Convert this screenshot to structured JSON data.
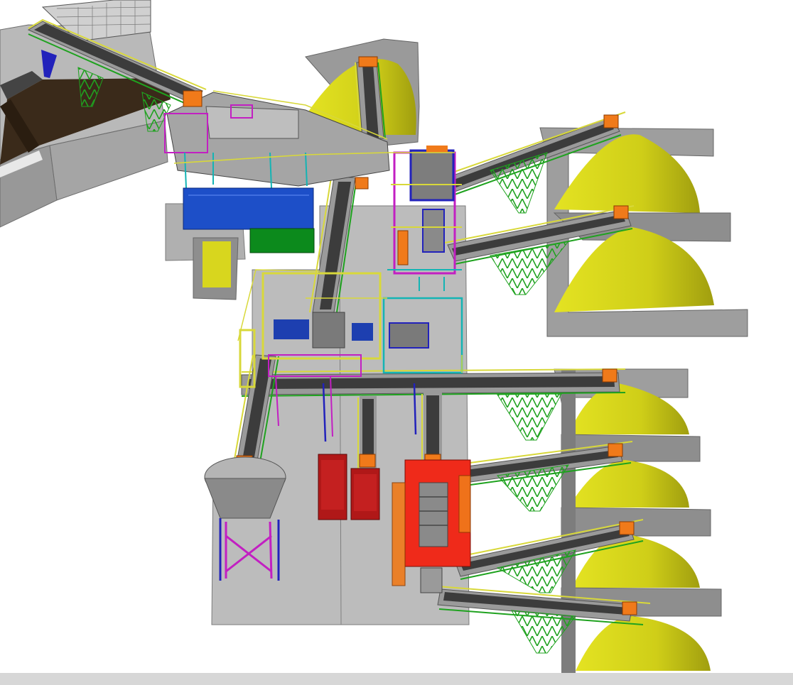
{
  "scene": {
    "kind": "3d-cad-model",
    "subject": "aggregate-crushing-and-screening-plant",
    "components": {
      "stockpiles": 6,
      "radial_stacker_conveyors": 7,
      "transfer_conveyors": 4,
      "screen_towers": 2,
      "hoppers": 1,
      "feeder_bins": 1,
      "rejects_skips": 2,
      "electrical_rooms": 2,
      "wash_plant_module": 1
    }
  },
  "colors": {
    "background": "#ffffff",
    "concrete": "#b4b4b4",
    "concrete_dark": "#8e8e8e",
    "wall_face": "#9a9a9a",
    "soil": "#3a2a1a",
    "stockpile": "#d7d61a",
    "stockpile_shade": "#9c9a10",
    "conveyor_belt": "#3c3c3c",
    "walkway": "#9a9a9a",
    "handrail": "#d8d83a",
    "support_truss": "#1fa21f",
    "structure_magenta": "#c21fc2",
    "structure_blue": "#2222bb",
    "structure_cyan": "#14b4b4",
    "drive_head": "#f07a1a",
    "electrical_room_blue": "#1d4fc8",
    "electrical_room_green": "#0c8a1c",
    "red_module": "#ef2a1a",
    "skip": "#b01818",
    "hopper_steel": "#8a8a8a",
    "ui_bar": "#d7d7d7"
  }
}
